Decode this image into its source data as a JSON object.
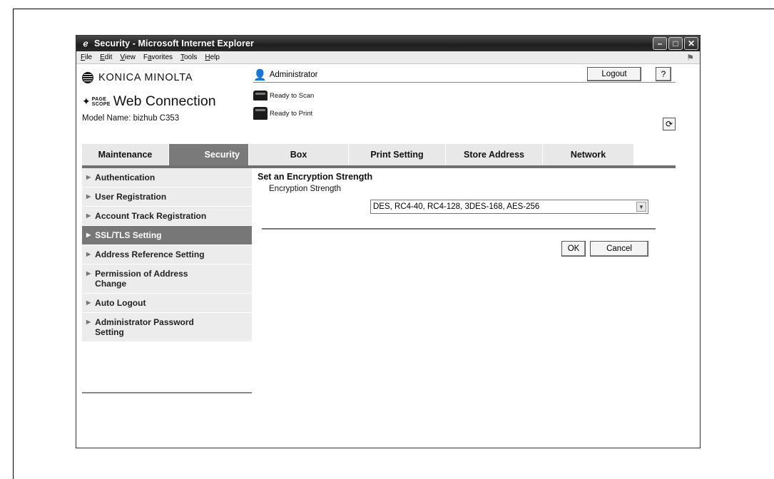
{
  "window": {
    "title": "Security - Microsoft Internet Explorer",
    "buttons": [
      "minimize",
      "maximize",
      "close"
    ]
  },
  "menubar": {
    "items": [
      {
        "label": "File",
        "accel": "F"
      },
      {
        "label": "Edit",
        "accel": "E"
      },
      {
        "label": "View",
        "accel": "V"
      },
      {
        "label": "Favorites",
        "accel": "a"
      },
      {
        "label": "Tools",
        "accel": "T"
      },
      {
        "label": "Help",
        "accel": "H"
      }
    ]
  },
  "header": {
    "brand": "KONICA MINOLTA",
    "product_prefix_top": "PAGE",
    "product_prefix_bottom": "SCOPE",
    "product": "Web Connection",
    "model": "Model Name: bizhub C353",
    "user": "Administrator",
    "logout_label": "Logout",
    "help_label": "?",
    "scan_status": "Ready to Scan",
    "print_status": "Ready to Print"
  },
  "tabs": [
    {
      "label": "Maintenance",
      "active": false
    },
    {
      "label": "Security",
      "active": true
    },
    {
      "label": "Box",
      "active": false
    },
    {
      "label": "Print Setting",
      "active": false
    },
    {
      "label": "Store Address",
      "active": false
    },
    {
      "label": "Network",
      "active": false
    }
  ],
  "sidebar": {
    "items": [
      {
        "label": "Authentication",
        "active": false
      },
      {
        "label": "User Registration",
        "active": false
      },
      {
        "label": "Account Track Registration",
        "active": false
      },
      {
        "label": "SSL/TLS Setting",
        "active": true
      },
      {
        "label": "Address Reference Setting",
        "active": false
      },
      {
        "label": "Permission of Address Change",
        "active": false
      },
      {
        "label": "Auto Logout",
        "active": false
      },
      {
        "label": "Administrator Password Setting",
        "active": false
      }
    ]
  },
  "main": {
    "section_title": "Set an Encryption Strength",
    "field_label": "Encryption Strength",
    "field_value": "DES, RC4-40, RC4-128, 3DES-168, AES-256",
    "ok_label": "OK",
    "cancel_label": "Cancel"
  }
}
